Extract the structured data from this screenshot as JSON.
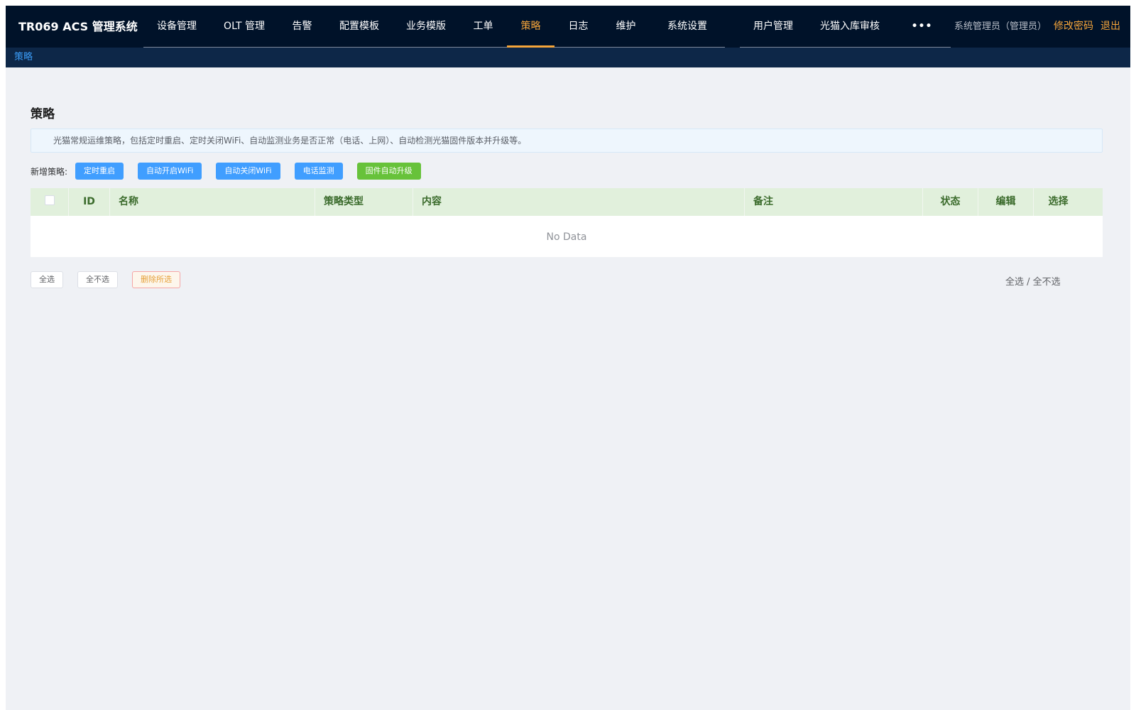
{
  "header": {
    "brand": "TR069 ACS 管理系统",
    "nav": [
      {
        "label": "设备管理",
        "active": false
      },
      {
        "label": "OLT 管理",
        "active": false
      },
      {
        "label": "告警",
        "active": false
      },
      {
        "label": "配置模板",
        "active": false
      },
      {
        "label": "业务模版",
        "active": false
      },
      {
        "label": "工单",
        "active": false
      },
      {
        "label": "策略",
        "active": true
      },
      {
        "label": "日志",
        "active": false
      },
      {
        "label": "维护",
        "active": false
      },
      {
        "label": "系统设置",
        "active": false
      }
    ],
    "nav_extra": [
      {
        "label": "用户管理"
      },
      {
        "label": "光猫入库审核"
      }
    ],
    "more_icon": "more-horizontal-icon",
    "more_glyph": "•••",
    "user": "系统管理员（管理员）",
    "change_password": "修改密码",
    "logout": "退出"
  },
  "breadcrumb": "策略",
  "page": {
    "title": "策略",
    "description": "光猫常规运维策略，包括定时重启、定时关闭WiFi、自动监测业务是否正常（电话、上网）、自动检测光猫固件版本并升级等。",
    "add_label": "新增策略:",
    "add_buttons": [
      {
        "label": "定时重启",
        "color": "#409eff"
      },
      {
        "label": "自动开启WiFi",
        "color": "#409eff"
      },
      {
        "label": "自动关闭WiFi",
        "color": "#409eff"
      },
      {
        "label": "电话监测",
        "color": "#409eff"
      },
      {
        "label": "固件自动升级",
        "color": "#67c23a"
      }
    ]
  },
  "table": {
    "columns": [
      "ID",
      "名称",
      "策略类型",
      "内容",
      "备注",
      "状态",
      "编辑",
      "选择"
    ],
    "empty_text": "No Data"
  },
  "footer": {
    "select_all": "全选",
    "select_none": "全不选",
    "delete_selected": "删除所选",
    "links_select_all": "全选",
    "links_separator": " / ",
    "links_select_none": "全不选"
  },
  "colors": {
    "topbar": "#001229",
    "breadbar": "#0d2748",
    "accent": "#f5a53a",
    "table_header_bg": "#e1f0dc",
    "table_header_text": "#3b6b2c"
  }
}
